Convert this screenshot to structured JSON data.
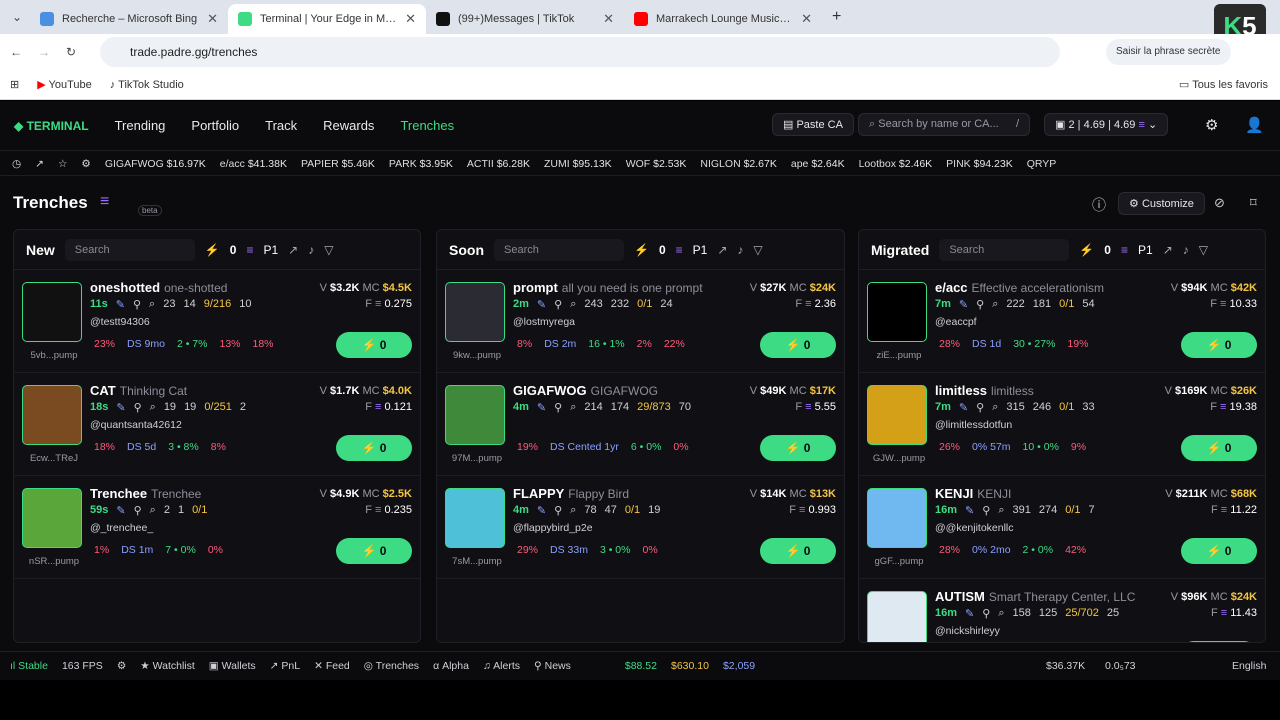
{
  "browser": {
    "tabs": [
      {
        "title": "Recherche – Microsoft Bing",
        "color": "#4a90e2"
      },
      {
        "title": "Terminal | Your Edge in Memecoins",
        "color": "#3ddc84"
      },
      {
        "title": "(99+)Messages | TikTok",
        "color": "#111111"
      },
      {
        "title": "Marrakech Lounge Music | Oud",
        "color": "#ff0000"
      }
    ],
    "url": "trade.padre.gg/trenches",
    "secret_phrase_button": "Saisir la phrase secrète",
    "bookmarks": [
      "YouTube",
      "TikTok Studio"
    ],
    "all_favorites": "Tous les favoris"
  },
  "nav": {
    "logo": "TERMINAL",
    "links": [
      "Trending",
      "Portfolio",
      "Track",
      "Rewards",
      "Trenches"
    ],
    "paste_ca": "Paste CA",
    "search_placeholder": "Search by name or CA...",
    "search_shortcut": "/",
    "wallet_count": "2",
    "balance1": "4.69",
    "balance2": "4.69"
  },
  "ticker": [
    {
      "name": "GIGAFWOG",
      "value": "$16.97K"
    },
    {
      "name": "e/acc",
      "value": "$41.38K"
    },
    {
      "name": "PAPIER",
      "value": "$5.46K"
    },
    {
      "name": "PARK",
      "value": "$3.95K"
    },
    {
      "name": "ACTII",
      "value": "$6.28K"
    },
    {
      "name": "ZUMI",
      "value": "$95.13K"
    },
    {
      "name": "WOF",
      "value": "$2.53K"
    },
    {
      "name": "NIGLON",
      "value": "$2.67K"
    },
    {
      "name": "ape",
      "value": "$2.64K"
    },
    {
      "name": "Lootbox",
      "value": "$2.46K"
    },
    {
      "name": "PINK",
      "value": "$94.23K"
    },
    {
      "name": "QRYP",
      "value": ""
    }
  ],
  "page": {
    "title": "Trenches",
    "beta": "beta",
    "customize": "Customize"
  },
  "columns": [
    {
      "name": "New",
      "search": "Search",
      "count": "0",
      "preset": "P1",
      "tokens": [
        {
          "ticker": "oneshotted",
          "name": "one-shotted",
          "age": "11s",
          "s1": "23",
          "s2": "14",
          "s3": "9/216",
          "s4": "10",
          "handle": "@testt94306",
          "v": "$3.2K",
          "mc": "$4.5K",
          "f": "0.275",
          "sub": "5vb...pump",
          "p1": "23%",
          "ds": "DS 9mo",
          "p2": "2 • 7%",
          "p3": "13%",
          "p4": "18%",
          "avatar": "#111111"
        },
        {
          "ticker": "CAT",
          "name": "Thinking Cat",
          "age": "18s",
          "s1": "19",
          "s2": "19",
          "s3": "0/251",
          "s4": "2",
          "handle": "@quantsanta42612",
          "v": "$1.7K",
          "mc": "$4.0K",
          "f": "0.121",
          "sub": "Ecw...TReJ",
          "p1": "18%",
          "ds": "DS 5d",
          "p2": "3 • 8%",
          "p3": "8%",
          "p4": "",
          "avatar": "#7a4a20"
        },
        {
          "ticker": "Trenchee",
          "name": "Trenchee",
          "age": "59s",
          "s1": "2",
          "s2": "1",
          "s3": "0/1",
          "s4": "",
          "handle": "@_trenchee_",
          "v": "$4.9K",
          "mc": "$2.5K",
          "f": "0.235",
          "sub": "nSR...pump",
          "p1": "1%",
          "ds": "DS 1m",
          "p2": "7 • 0%",
          "p3": "0%",
          "p4": "",
          "avatar": "#5aa63a"
        }
      ]
    },
    {
      "name": "Soon",
      "search": "Search",
      "count": "0",
      "preset": "P1",
      "tokens": [
        {
          "ticker": "prompt",
          "name": "all you need is one prompt",
          "age": "2m",
          "s1": "243",
          "s2": "232",
          "s3": "0/1",
          "s4": "24",
          "handle": "@lostmyrega",
          "v": "$27K",
          "mc": "$24K",
          "f": "2.36",
          "sub": "9kw...pump",
          "p1": "8%",
          "ds": "DS 2m",
          "p2": "16 • 1%",
          "p3": "2%",
          "p4": "22%",
          "avatar": "#2b2b33"
        },
        {
          "ticker": "GIGAFWOG",
          "name": "GIGAFWOG",
          "age": "4m",
          "s1": "214",
          "s2": "174",
          "s3": "29/873",
          "s4": "70",
          "handle": "",
          "v": "$49K",
          "mc": "$17K",
          "f": "5.55",
          "sub": "97M...pump",
          "p1": "19%",
          "ds": "DS Cented 1yr",
          "p2": "6 • 0%",
          "p3": "0%",
          "p4": "",
          "avatar": "#3f8a3a"
        },
        {
          "ticker": "FLAPPY",
          "name": "Flappy Bird",
          "age": "4m",
          "s1": "78",
          "s2": "47",
          "s3": "0/1",
          "s4": "19",
          "handle": "@flappybird_p2e",
          "v": "$14K",
          "mc": "$13K",
          "f": "0.993",
          "sub": "7sM...pump",
          "p1": "29%",
          "ds": "DS 33m",
          "p2": "3 • 0%",
          "p3": "0%",
          "p4": "",
          "avatar": "#4ec0d8"
        }
      ]
    },
    {
      "name": "Migrated",
      "search": "Search",
      "count": "0",
      "preset": "P1",
      "tokens": [
        {
          "ticker": "e/acc",
          "name": "Effective accelerationism",
          "age": "7m",
          "s1": "222",
          "s2": "181",
          "s3": "0/1",
          "s4": "54",
          "handle": "@eaccpf",
          "v": "$94K",
          "mc": "$42K",
          "f": "10.33",
          "sub": "ziE...pump",
          "p1": "28%",
          "ds": "DS 1d",
          "p2": "30 • 27%",
          "p3": "19%",
          "p4": "",
          "avatar": "#000000"
        },
        {
          "ticker": "limitless",
          "name": "limitless",
          "age": "7m",
          "s1": "315",
          "s2": "246",
          "s3": "0/1",
          "s4": "33",
          "handle": "@limitlessdotfun",
          "v": "$169K",
          "mc": "$26K",
          "f": "19.38",
          "sub": "GJW...pump",
          "p1": "26%",
          "ds": "0% 57m",
          "p2": "10 • 0%",
          "p3": "9%",
          "p4": "",
          "avatar": "#d4a017"
        },
        {
          "ticker": "KENJI",
          "name": "KENJI",
          "age": "16m",
          "s1": "391",
          "s2": "274",
          "s3": "0/1",
          "s4": "7",
          "handle": "@@kenjitokenllc",
          "v": "$211K",
          "mc": "$68K",
          "f": "11.22",
          "sub": "gGF...pump",
          "p1": "28%",
          "ds": "0% 2mo",
          "p2": "2 • 0%",
          "p3": "42%",
          "p4": "",
          "avatar": "#6fb8f0"
        },
        {
          "ticker": "AUTISM",
          "name": "Smart Therapy Center, LLC",
          "age": "16m",
          "s1": "158",
          "s2": "125",
          "s3": "25/702",
          "s4": "25",
          "handle": "@nickshirleyy",
          "v": "$96K",
          "mc": "$24K",
          "f": "11.43",
          "sub": "",
          "p1": "",
          "ds": "",
          "p2": "",
          "p3": "",
          "p4": "",
          "avatar": "#dfe9f2"
        }
      ]
    }
  ],
  "buy_label": "0",
  "footer": {
    "status": "Stable",
    "fps": "163 FPS",
    "items": [
      "Watchlist",
      "Wallets",
      "PnL",
      "Feed",
      "Trenches",
      "Alpha",
      "Alerts",
      "News"
    ],
    "prices": [
      "$88.52",
      "$630.10",
      "$2,059"
    ],
    "right": [
      "$36.37K",
      "0.0₅73",
      "English"
    ]
  }
}
